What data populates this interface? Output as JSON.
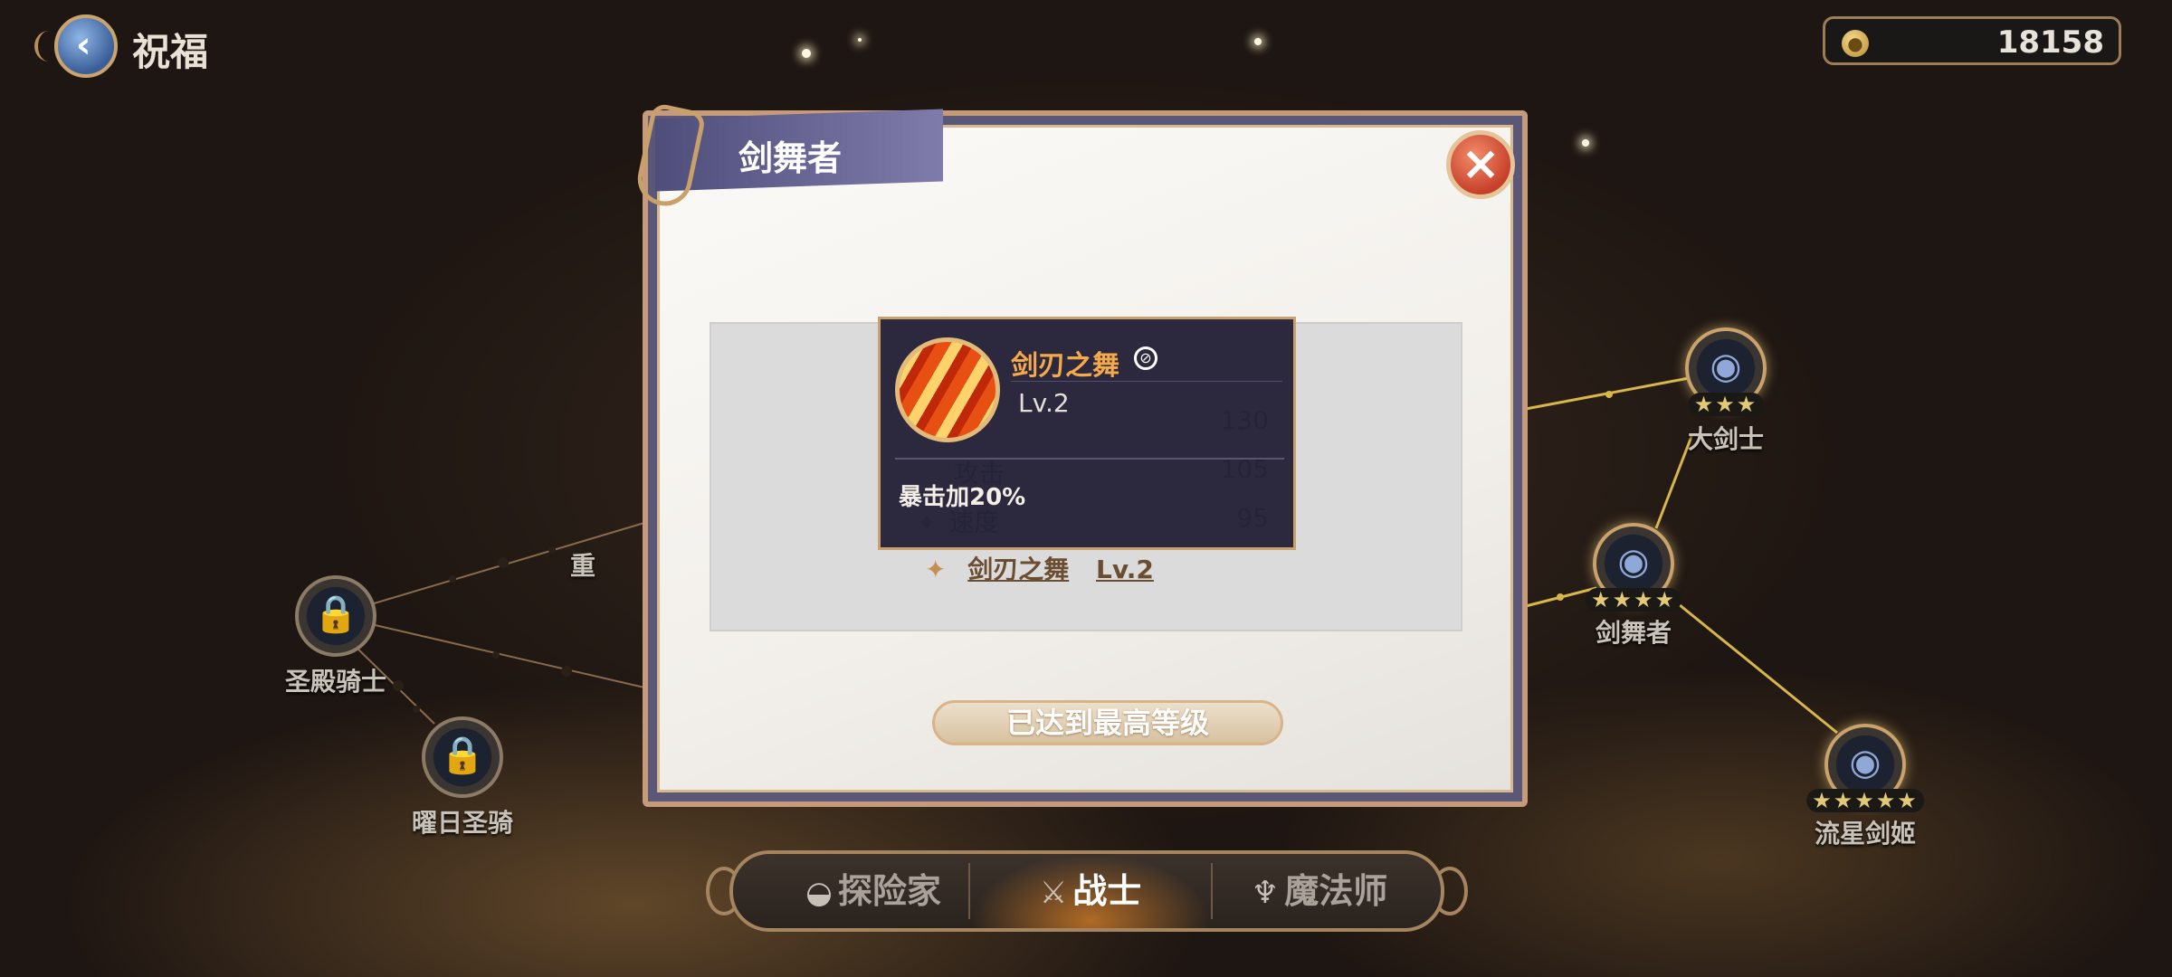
{
  "header": {
    "title": "祝福",
    "back_icon": "chevron-left-icon"
  },
  "currency": {
    "icon": "coin-icon",
    "value": "18158"
  },
  "constellation": {
    "nodes": [
      {
        "label": "圣殿骑士",
        "state": "locked"
      },
      {
        "label": "曜日圣骑",
        "state": "locked"
      },
      {
        "label": "重",
        "state": "partial-hidden"
      },
      {
        "label": "大剑士",
        "stars": "★★★",
        "state": "unlocked"
      },
      {
        "label": "剑舞者",
        "stars": "★★★★",
        "state": "unlocked"
      },
      {
        "label": "流星剑姬",
        "stars": "★★★★★",
        "state": "unlocked"
      }
    ]
  },
  "dialog": {
    "title": "剑舞者",
    "close_icon": "close-icon",
    "stats": [
      {
        "value": "130"
      },
      {
        "label": "攻击",
        "value": "105"
      },
      {
        "label": "速度",
        "value": "95"
      }
    ],
    "skill": {
      "name": "剑刃之舞",
      "level": "Lv.2"
    },
    "max_button": "已达到最高等级"
  },
  "tooltip": {
    "name": "剑刃之舞",
    "level": "Lv.2",
    "description": "暴击加20%"
  },
  "class_tabs": [
    {
      "label": "探险家",
      "icon": "explorer-icon",
      "active": false
    },
    {
      "label": "战士",
      "icon": "warrior-icon",
      "active": true
    },
    {
      "label": "魔法师",
      "icon": "mage-icon",
      "active": false
    }
  ]
}
